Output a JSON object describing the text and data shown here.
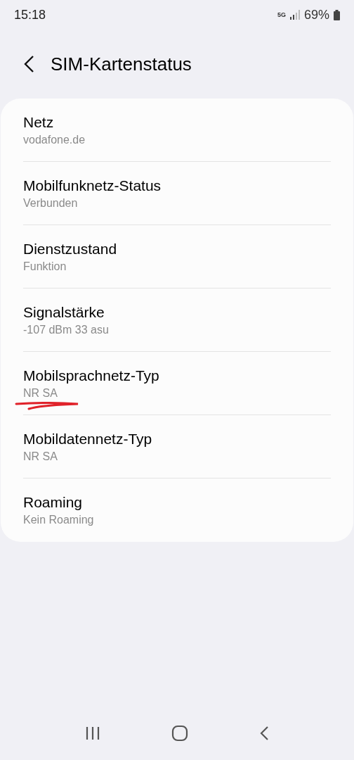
{
  "status_bar": {
    "time": "15:18",
    "network": "5G",
    "battery": "69%"
  },
  "header": {
    "title": "SIM-Kartenstatus"
  },
  "items": [
    {
      "title": "Netz",
      "value": "vodafone.de",
      "underlined": false
    },
    {
      "title": "Mobilfunknetz-Status",
      "value": "Verbunden",
      "underlined": false
    },
    {
      "title": "Dienstzustand",
      "value": "Funktion",
      "underlined": false
    },
    {
      "title": "Signalstärke",
      "value": "-107 dBm 33 asu",
      "underlined": false
    },
    {
      "title": "Mobilsprachnetz-Typ",
      "value": "NR SA",
      "underlined": true
    },
    {
      "title": "Mobildatennetz-Typ",
      "value": "NR SA",
      "underlined": false
    },
    {
      "title": "Roaming",
      "value": "Kein Roaming",
      "underlined": false
    }
  ]
}
